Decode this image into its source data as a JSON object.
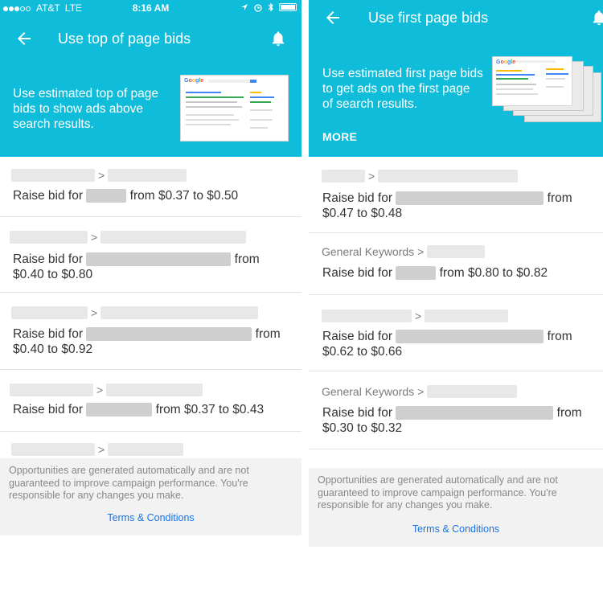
{
  "status_bar": {
    "carrier": "AT&T",
    "network": "LTE",
    "time": "8:16 AM"
  },
  "left": {
    "title": "Use top of page bids",
    "banner": "Use estimated top of page bids to show ads above search results.",
    "items": [
      {
        "raise_prefix": "Raise bid for",
        "from_to": "from $0.37 to $0.50"
      },
      {
        "raise_prefix": "Raise bid for",
        "from_word": "from",
        "range": "$0.40 to $0.80"
      },
      {
        "raise_prefix": "Raise bid for",
        "from_word": "from",
        "range": "$0.40 to $0.92"
      },
      {
        "raise_prefix": "Raise bid for",
        "from_to": "from $0.37 to $0.43"
      }
    ],
    "disclaimer": "Opportunities are generated automatically and are not guaranteed to improve campaign performance. You're responsible for any changes you make.",
    "terms": "Terms & Conditions"
  },
  "right": {
    "title": "Use first page bids",
    "banner": "Use estimated first page bids to get ads on the first page of search results.",
    "more": "MORE",
    "items": [
      {
        "raise_prefix": "Raise bid for",
        "from_word": "from",
        "range": "$0.47 to $0.48"
      },
      {
        "crumb": "General Keywords",
        "raise_prefix": "Raise bid for",
        "from_to": "from $0.80 to $0.82"
      },
      {
        "raise_prefix": "Raise bid for",
        "from_word": "from",
        "range": "$0.62 to $0.66"
      },
      {
        "crumb": "General Keywords",
        "raise_prefix": "Raise bid for",
        "from_word": "from",
        "range": "$0.30 to $0.32"
      }
    ],
    "disclaimer": "Opportunities are generated automatically and are not guaranteed to improve campaign performance. You're responsible for any changes you make.",
    "terms": "Terms & Conditions"
  },
  "google_logo": "Google",
  "crumb_separator": ">",
  "icons": {
    "back": "arrow-back-icon",
    "bell": "bell-icon",
    "location": "location-arrow-icon",
    "alarm": "alarm-icon",
    "bluetooth": "bluetooth-icon",
    "battery": "battery-icon"
  },
  "colors": {
    "header": "#0fbcd9",
    "link": "#1a73e8",
    "footer_bg": "#f2f2f2"
  }
}
